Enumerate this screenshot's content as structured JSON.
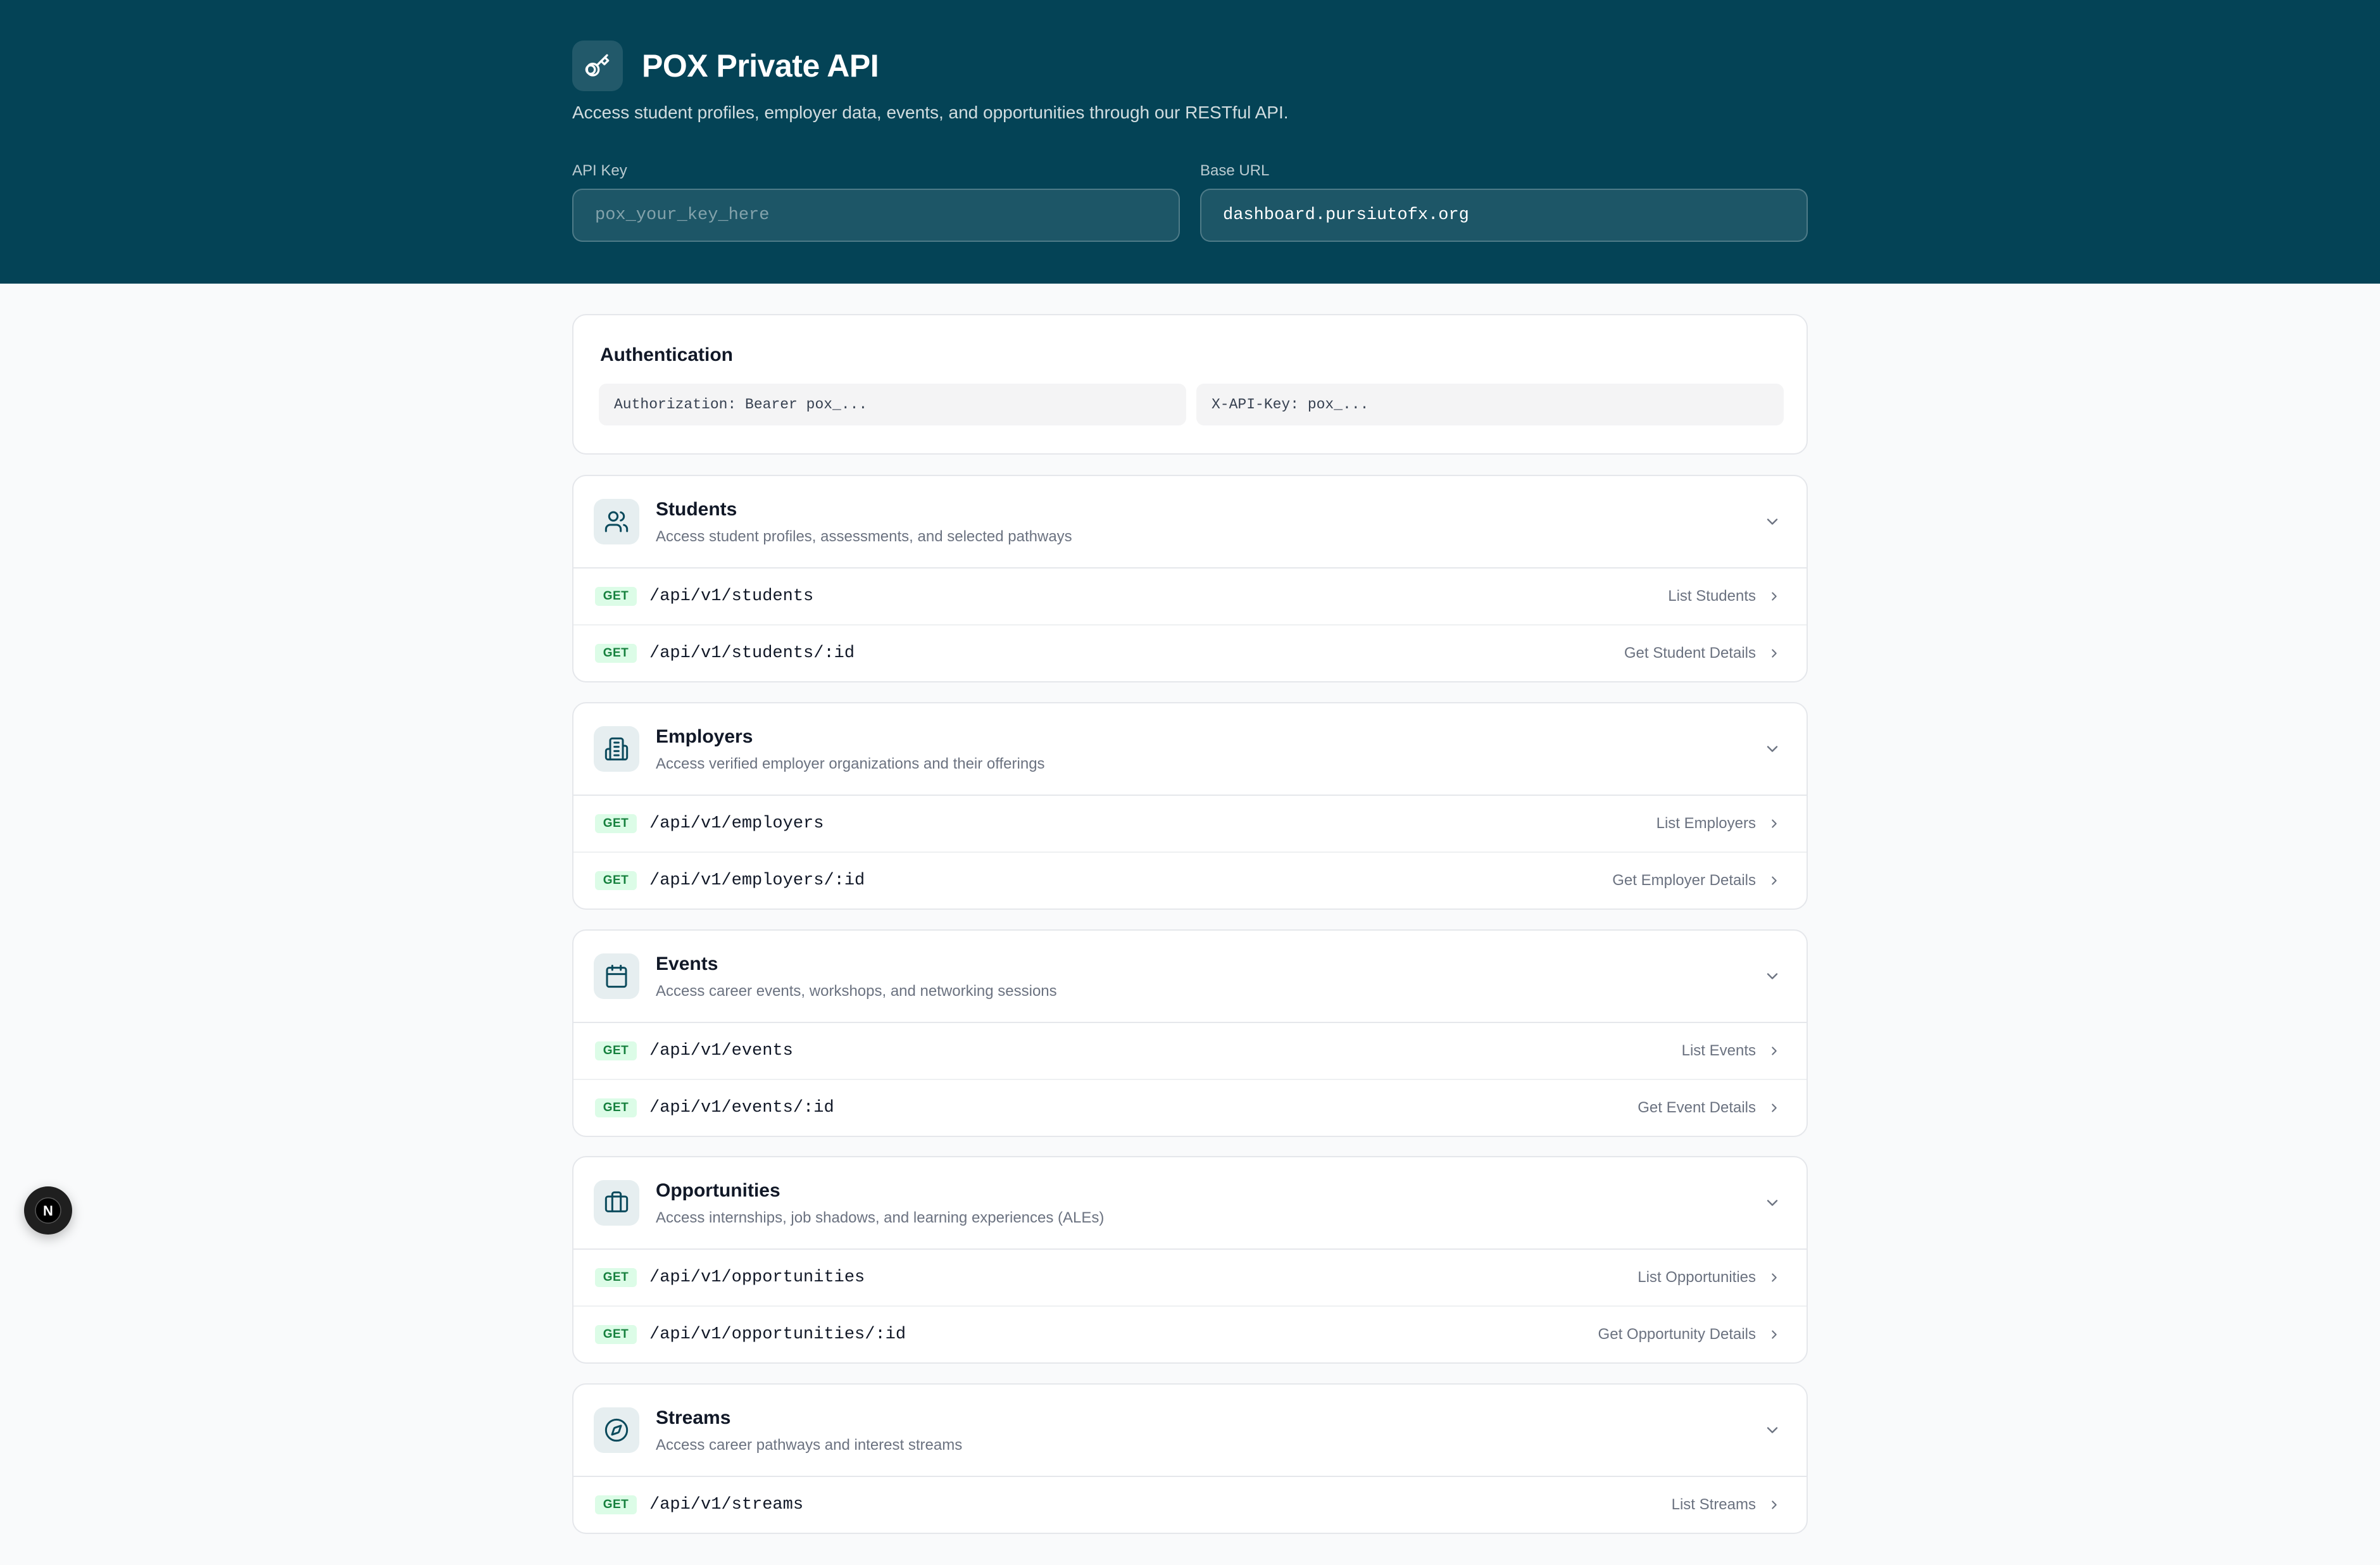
{
  "header": {
    "title": "POX Private API",
    "subtitle": "Access student profiles, employer data, events, and opportunities through our RESTful API.",
    "api_key": {
      "label": "API Key",
      "placeholder": "pox_your_key_here",
      "value": ""
    },
    "base_url": {
      "label": "Base URL",
      "value": "dashboard.pursiutofx.org"
    },
    "colors": {
      "background": "#044356"
    }
  },
  "auth": {
    "title": "Authentication",
    "bearer": "Authorization: Bearer pox_...",
    "header_key": "X-API-Key: pox_..."
  },
  "sections": [
    {
      "icon": "users-icon",
      "title": "Students",
      "description": "Access student profiles, assessments, and selected pathways",
      "endpoints": [
        {
          "method": "GET",
          "path": "/api/v1/students",
          "name": "List Students"
        },
        {
          "method": "GET",
          "path": "/api/v1/students/:id",
          "name": "Get Student Details"
        }
      ]
    },
    {
      "icon": "building-icon",
      "title": "Employers",
      "description": "Access verified employer organizations and their offerings",
      "endpoints": [
        {
          "method": "GET",
          "path": "/api/v1/employers",
          "name": "List Employers"
        },
        {
          "method": "GET",
          "path": "/api/v1/employers/:id",
          "name": "Get Employer Details"
        }
      ]
    },
    {
      "icon": "calendar-icon",
      "title": "Events",
      "description": "Access career events, workshops, and networking sessions",
      "endpoints": [
        {
          "method": "GET",
          "path": "/api/v1/events",
          "name": "List Events"
        },
        {
          "method": "GET",
          "path": "/api/v1/events/:id",
          "name": "Get Event Details"
        }
      ]
    },
    {
      "icon": "briefcase-icon",
      "title": "Opportunities",
      "description": "Access internships, job shadows, and learning experiences (ALEs)",
      "endpoints": [
        {
          "method": "GET",
          "path": "/api/v1/opportunities",
          "name": "List Opportunities"
        },
        {
          "method": "GET",
          "path": "/api/v1/opportunities/:id",
          "name": "Get Opportunity Details"
        }
      ]
    },
    {
      "icon": "compass-icon",
      "title": "Streams",
      "description": "Access career pathways and interest streams",
      "endpoints": [
        {
          "method": "GET",
          "path": "/api/v1/streams",
          "name": "List Streams"
        }
      ]
    }
  ],
  "fab": {
    "label": "N",
    "icon": "nextjs-logo-icon"
  }
}
